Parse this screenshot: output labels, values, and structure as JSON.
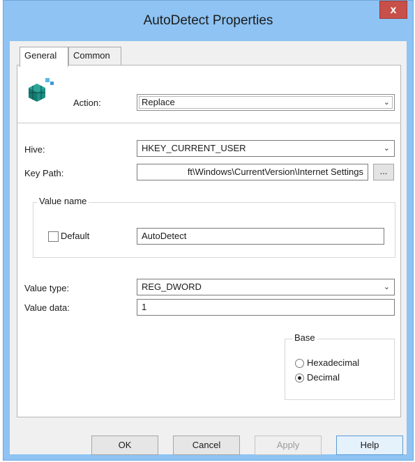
{
  "window": {
    "title": "AutoDetect Properties",
    "close_glyph": "x"
  },
  "tabs": [
    {
      "label": "General",
      "active": true
    },
    {
      "label": "Common",
      "active": false
    }
  ],
  "form": {
    "action_label": "Action:",
    "action_value": "Replace",
    "hive_label": "Hive:",
    "hive_value": "HKEY_CURRENT_USER",
    "key_path_label": "Key Path:",
    "key_path_value": "ft\\Windows\\CurrentVersion\\Internet Settings",
    "browse_label": "...",
    "value_name_group": "Value name",
    "default_label": "Default",
    "default_checked": false,
    "value_name_value": "AutoDetect",
    "value_type_label": "Value type:",
    "value_type_value": "REG_DWORD",
    "value_data_label": "Value data:",
    "value_data_value": "1",
    "base_group": "Base",
    "base_options": [
      {
        "label": "Hexadecimal",
        "checked": false
      },
      {
        "label": "Decimal",
        "checked": true
      }
    ]
  },
  "buttons": {
    "ok": "OK",
    "cancel": "Cancel",
    "apply": "Apply",
    "help": "Help"
  },
  "icons": {
    "action_icon": "registry-cubes-icon",
    "dropdown_arrow": "chevron-down-icon"
  },
  "colors": {
    "titlebar": "#8ec3f3",
    "close_button": "#c7504a",
    "default_button_border": "#5b9bd5"
  }
}
